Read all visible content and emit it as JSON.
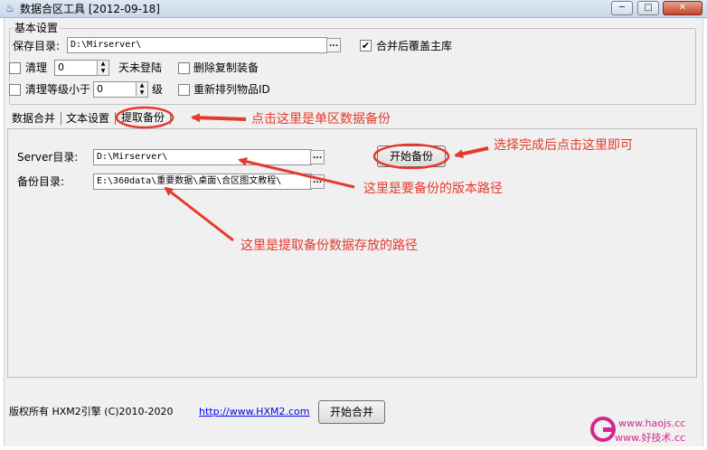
{
  "window": {
    "title": "数据合区工具 [2012-09-18]",
    "icon": "app-icon",
    "app_icon_glyph": "♨",
    "minimize_glyph": "─",
    "maximize_glyph": "□",
    "close_glyph": "✕"
  },
  "basic_settings": {
    "legend": "基本设置",
    "save_dir_label": "保存目录:",
    "save_dir_value": "D:\\Mirserver\\",
    "browse_label": "...",
    "merge_overwrite_label": "合并后覆盖主库",
    "merge_overwrite_checked": true,
    "checked_glyph": "✔",
    "clean_label": "清理",
    "clean_days_value": "0",
    "days_unlogged_label": "天未登陆",
    "delete_dup_equip_label": "删除复制装备",
    "delete_dup_equip_checked": false,
    "clean_level_label": "清理等级小于",
    "clean_level_value": "0",
    "level_unit_label": "级",
    "reorder_items_label": "重新排列物品ID",
    "reorder_items_checked": false,
    "spin_up": "▲",
    "spin_down": "▼"
  },
  "tabs": [
    {
      "label": "数据合并",
      "active": false
    },
    {
      "label": "文本设置",
      "active": false
    },
    {
      "label": "提取备份",
      "active": true
    }
  ],
  "backup_tab": {
    "server_dir_label": "Server目录:",
    "server_dir_value": "D:\\Mirserver\\",
    "backup_dir_label": "备份目录:",
    "backup_dir_value": "E:\\360data\\重要数据\\桌面\\合区图文教程\\",
    "browse_label": "...",
    "start_backup_label": "开始备份"
  },
  "footer": {
    "copyright": "版权所有 HXM2引擎 (C)2010-2020",
    "link": "http://www.HXM2.com",
    "start_merge_label": "开始合并"
  },
  "annotations": {
    "click_here_backup": "点击这里是单区数据备份",
    "after_select_click": "选择完成后点击这里即可",
    "version_path": "这里是要备份的版本路径",
    "backup_store_path": "这里是提取备份数据存放的路径",
    "arrow_color": "#e43a2e"
  },
  "watermark": {
    "line1": "www.haojs.cc",
    "line2": "www.好技术.cc",
    "color": "#d8248f"
  }
}
